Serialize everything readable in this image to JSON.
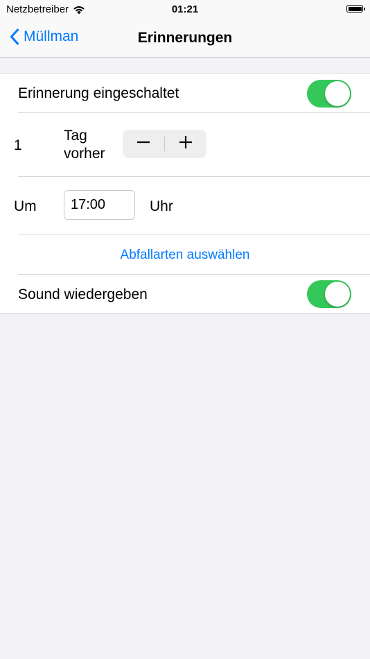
{
  "status_bar": {
    "carrier": "Netzbetreiber",
    "time": "01:21"
  },
  "nav": {
    "back_label": "Müllman",
    "title": "Erinnerungen"
  },
  "settings": {
    "reminder_label": "Erinnerung eingeschaltet",
    "reminder_on": true,
    "days_value": "1",
    "days_unit_line1": "Tag",
    "days_unit_line2": "vorher",
    "at_label": "Um",
    "time_value": "17:00",
    "time_suffix": "Uhr",
    "select_types_link": "Abfallarten auswählen",
    "sound_label": "Sound wiedergeben",
    "sound_on": true
  },
  "colors": {
    "accent": "#007aff",
    "switch_on": "#34c759",
    "background": "#f2f2f7"
  }
}
